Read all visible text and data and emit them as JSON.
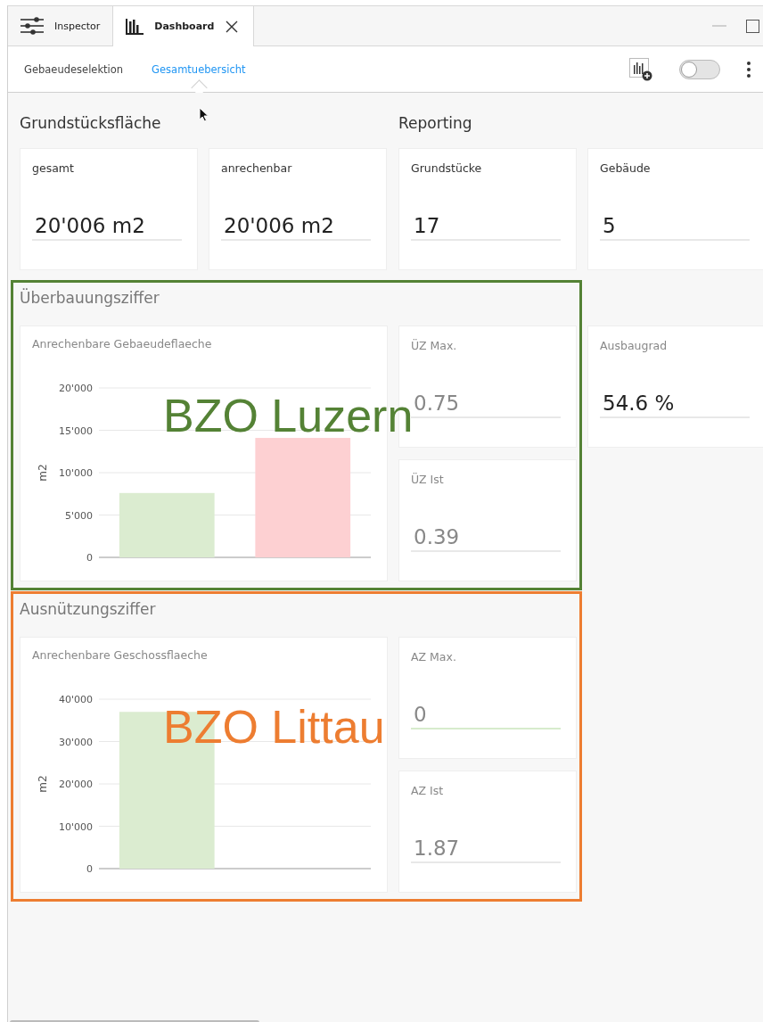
{
  "tabs": [
    {
      "label": "Inspector",
      "selected": false
    },
    {
      "label": "Dashboard",
      "selected": true
    }
  ],
  "nav": [
    {
      "label": "Gebaeudeselektion",
      "selected": false
    },
    {
      "label": "Gesamtuebersicht",
      "selected": true
    }
  ],
  "toggle": {
    "on": false
  },
  "overview": [
    {
      "title": "Grundstücksfläche",
      "cards": [
        {
          "label": "gesamt",
          "value": "20'006 m2",
          "muted": false,
          "highlighted": false
        },
        {
          "label": "anrechenbar",
          "value": "20'006 m2",
          "muted": false,
          "highlighted": false
        }
      ]
    },
    {
      "title": "Reporting",
      "cards": [
        {
          "label": "Grundstücke",
          "value": "17",
          "muted": false,
          "highlighted": false
        },
        {
          "label": "Gebäude",
          "value": "5",
          "muted": false,
          "highlighted": false
        }
      ]
    }
  ],
  "sections": [
    {
      "title": "Überbauungsziffer",
      "annotation": {
        "text": "BZO Luzern",
        "color": "#548235"
      },
      "chart_card": {
        "title": "Anrechenbare Gebaeudeflaeche",
        "chart_data": {
          "type": "bar",
          "grid": true,
          "ylabel": "m2",
          "ylim": [
            0,
            20000
          ],
          "yticks": [
            {
              "value": 0,
              "label": "0"
            },
            {
              "value": 5000,
              "label": "5'000"
            },
            {
              "value": 10000,
              "label": "10'000"
            },
            {
              "value": 15000,
              "label": "15'000"
            },
            {
              "value": 20000,
              "label": "20'000"
            }
          ],
          "series": [
            {
              "color": "#dbecd0",
              "values": [
                7600,
                null
              ]
            },
            {
              "color": "#fdd0d2",
              "values": [
                null,
                14100
              ]
            }
          ]
        }
      },
      "cards": [
        {
          "label": "ÜZ Max.",
          "value": "0.75",
          "muted": true,
          "highlighted": false
        },
        {
          "label": "ÜZ Ist",
          "value": "0.39",
          "muted": true,
          "highlighted": false
        }
      ],
      "side_cards": [
        {
          "label": "Ausbaugrad",
          "value": "54.6 %",
          "muted": false,
          "highlighted": false
        }
      ]
    },
    {
      "title": "Ausnützungsziffer",
      "annotation": {
        "text": "BZO Littau",
        "color": "#ed7d31"
      },
      "chart_card": {
        "title": "Anrechenbare Geschossflaeche",
        "chart_data": {
          "type": "bar",
          "grid": true,
          "ylabel": "m2",
          "ylim": [
            0,
            40000
          ],
          "yticks": [
            {
              "value": 0,
              "label": "0"
            },
            {
              "value": 10000,
              "label": "10'000"
            },
            {
              "value": 20000,
              "label": "20'000"
            },
            {
              "value": 30000,
              "label": "30'000"
            },
            {
              "value": 40000,
              "label": "40'000"
            }
          ],
          "series": [
            {
              "color": "#dbecd0",
              "values": [
                37000,
                null
              ]
            }
          ]
        }
      },
      "cards": [
        {
          "label": "AZ Max.",
          "value": "0",
          "muted": true,
          "highlighted": true
        },
        {
          "label": "AZ Ist",
          "value": "1.87",
          "muted": true,
          "highlighted": false
        }
      ]
    }
  ]
}
